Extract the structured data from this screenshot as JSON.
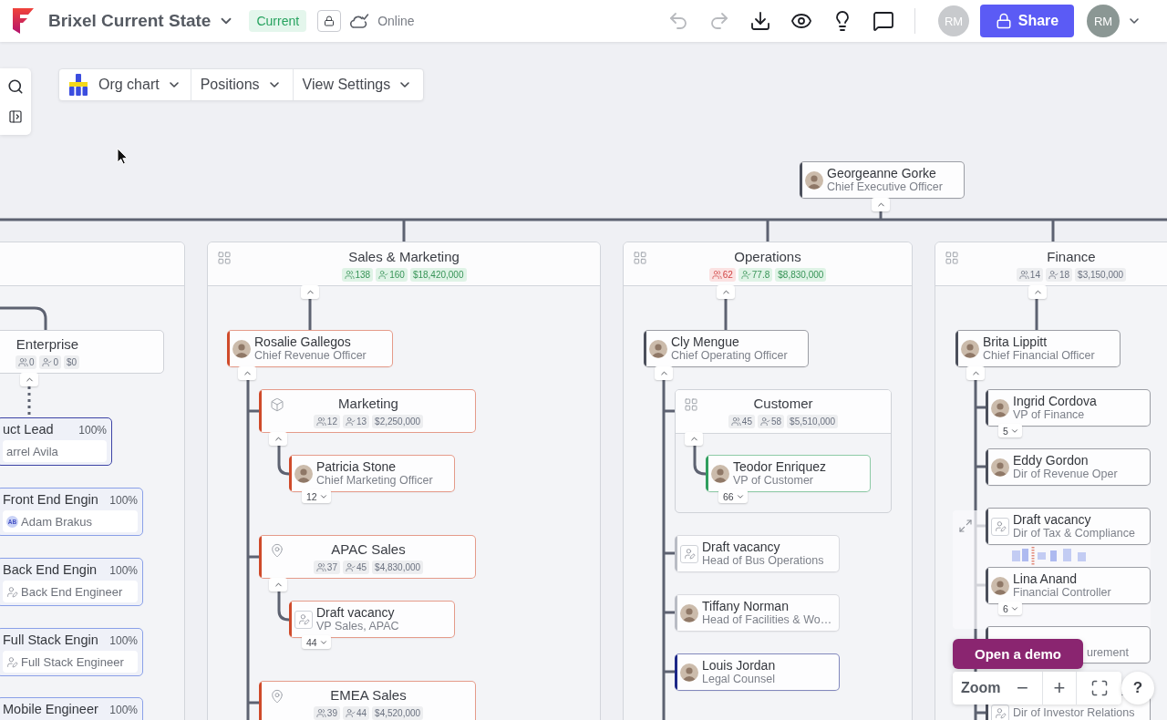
{
  "app_bar": {
    "title": "Brixel Current State",
    "status": "Current",
    "connection": "Online",
    "actions": [
      {
        "kind": "undo",
        "disabled": true
      },
      {
        "kind": "redo",
        "disabled": true
      },
      {
        "kind": "download",
        "disabled": false
      },
      {
        "kind": "preview",
        "disabled": false
      },
      {
        "kind": "insights",
        "disabled": false
      },
      {
        "kind": "comments",
        "disabled": false
      }
    ],
    "collaborator": "RM",
    "share": "Share",
    "account": "RM"
  },
  "view_toolbar": [
    {
      "kind": "chart",
      "label": "Org chart"
    },
    {
      "kind": "menu",
      "label": "Positions"
    },
    {
      "kind": "menu",
      "label": "View Settings"
    }
  ],
  "org_chart": {
    "root": {
      "kind": "person",
      "name": "Georgeanne Gorke",
      "role": "Chief Executive Officer",
      "color": "#4b4f5b",
      "expanded": true
    },
    "departments": [
      {
        "children": [
          {
            "kind": "unit",
            "title": "Enterprise",
            "stats": [
              {
                "kind": "people",
                "value": "0",
                "color": "#edeef0"
              },
              {
                "kind": "positions",
                "value": "0",
                "color": "#edeef0"
              },
              {
                "kind": "budget",
                "value": "$0",
                "color": "#edeef0"
              }
            ],
            "expanded": true,
            "children": [
              {
                "kind": "position",
                "title": "uct Lead",
                "fill": "100%",
                "holder": {
                  "name": "arrel Avila"
                },
                "color": "#3d44a6"
              }
            ]
          },
          {
            "kind": "position",
            "title": "Front End Engin",
            "fill": "100%",
            "holder": {
              "kind": "person",
              "initials": "AB",
              "name": "Adam Brakus"
            },
            "color": "#8aa0e8"
          },
          {
            "kind": "position",
            "title": "Back End Engin",
            "fill": "100%",
            "holder": {
              "kind": "vacancy",
              "name": "Back End Engineer"
            },
            "color": "#8aa0e8"
          },
          {
            "kind": "position",
            "title": "Full Stack Engin",
            "fill": "100%",
            "holder": {
              "kind": "vacancy",
              "name": "Full Stack Engineer"
            },
            "color": "#8aa0e8"
          },
          {
            "kind": "position",
            "title": "Mobile Engineer",
            "fill": "100%",
            "color": "#8aa0e8"
          }
        ]
      },
      {
        "kind": "group",
        "title": "Sales & Marketing",
        "stats": [
          {
            "kind": "people",
            "value": "138",
            "color": "#dff3e6"
          },
          {
            "kind": "positions",
            "value": "160",
            "color": "#dff3e6"
          },
          {
            "kind": "budget",
            "value": "$18,420,000",
            "color": "#dff3e6"
          }
        ],
        "expanded": true,
        "children": [
          {
            "kind": "person",
            "name": "Rosalie Gallegos",
            "role": "Chief Revenue Officer",
            "color": "#cf4a2a",
            "expanded": true,
            "children": [
              {
                "kind": "function",
                "title": "Marketing",
                "stats": [
                  {
                    "kind": "people",
                    "value": "12",
                    "color": "#edeef0"
                  },
                  {
                    "kind": "positions",
                    "value": "13",
                    "color": "#edeef0"
                  },
                  {
                    "kind": "budget",
                    "value": "$2,250,000",
                    "color": "#edeef0"
                  }
                ],
                "color": "#cf4a2a",
                "expanded": true,
                "children": [
                  {
                    "kind": "person",
                    "name": "Patricia Stone",
                    "role": "Chief Marketing Officer",
                    "color": "#cf4a2a",
                    "expanded": false,
                    "reports": "12"
                  }
                ]
              },
              {
                "kind": "location",
                "title": "APAC Sales",
                "stats": [
                  {
                    "kind": "people",
                    "value": "37",
                    "color": "#edeef0"
                  },
                  {
                    "kind": "positions",
                    "value": "45",
                    "color": "#edeef0"
                  },
                  {
                    "kind": "budget",
                    "value": "$4,830,000",
                    "color": "#edeef0"
                  }
                ],
                "color": "#cf4a2a",
                "expanded": true,
                "children": [
                  {
                    "kind": "vacancy",
                    "name": "Draft vacancy",
                    "role": "VP Sales, APAC",
                    "color": "#cf4a2a",
                    "expanded": false,
                    "reports": "44"
                  }
                ]
              },
              {
                "kind": "location",
                "title": "EMEA Sales",
                "stats": [
                  {
                    "kind": "people",
                    "value": "39",
                    "color": "#edeef0"
                  },
                  {
                    "kind": "positions",
                    "value": "44",
                    "color": "#edeef0"
                  },
                  {
                    "kind": "budget",
                    "value": "$4,520,000",
                    "color": "#edeef0"
                  }
                ],
                "color": "#cf4a2a"
              }
            ]
          }
        ]
      },
      {
        "kind": "group",
        "title": "Operations",
        "stats": [
          {
            "kind": "people",
            "value": "62",
            "color": "#fbe2e2"
          },
          {
            "kind": "positions",
            "value": "77.8",
            "color": "#dff3e6"
          },
          {
            "kind": "budget",
            "value": "$8,830,000",
            "color": "#dff3e6"
          }
        ],
        "expanded": true,
        "children": [
          {
            "kind": "person",
            "name": "Cly Mengue",
            "role": "Chief Operating Officer",
            "color": "#4b4f5b",
            "expanded": true,
            "children": [
              {
                "kind": "group",
                "title": "Customer",
                "stats": [
                  {
                    "kind": "people",
                    "value": "45",
                    "color": "#edeef0"
                  },
                  {
                    "kind": "positions",
                    "value": "58",
                    "color": "#edeef0"
                  },
                  {
                    "kind": "budget",
                    "value": "$5,510,000",
                    "color": "#edeef0"
                  }
                ],
                "expanded": true,
                "children": [
                  {
                    "kind": "person",
                    "name": "Teodor Enriquez",
                    "role": "VP of Customer",
                    "color": "#2f9e5e",
                    "expanded": false,
                    "reports": "66"
                  }
                ]
              },
              {
                "kind": "vacancy",
                "name": "Draft vacancy",
                "role": "Head of Bus Operations",
                "color": "#b9bcc4"
              },
              {
                "kind": "person",
                "name": "Tiffany Norman",
                "role": "Head of Facilities & Wo…",
                "color": "#b9bcc4"
              },
              {
                "kind": "person",
                "name": "Louis Jordan",
                "role": "Legal Counsel",
                "color": "#1c2787"
              }
            ]
          }
        ]
      },
      {
        "kind": "group",
        "title": "Finance",
        "stats": [
          {
            "kind": "people",
            "value": "14",
            "color": "#edeef0"
          },
          {
            "kind": "positions",
            "value": "18",
            "color": "#edeef0"
          },
          {
            "kind": "budget",
            "value": "$3,150,000",
            "color": "#edeef0"
          }
        ],
        "expanded": true,
        "children": [
          {
            "kind": "person",
            "name": "Brita Lippitt",
            "role": "Chief Financial Officer",
            "color": "#4b4f5b",
            "expanded": true,
            "children": [
              {
                "kind": "person",
                "name": "Ingrid Cordova",
                "role": "VP of Finance",
                "color": "#4b4f5b",
                "expanded": false,
                "reports": "5"
              },
              {
                "kind": "person",
                "name": "Eddy Gordon",
                "role": "Dir of Revenue Oper",
                "color": "#4b4f5b"
              },
              {
                "kind": "vacancy",
                "name": "Draft vacancy",
                "role": "Dir of Tax & Compliance",
                "color": "#4b4f5b"
              },
              {
                "kind": "person",
                "name": "Lina Anand",
                "role": "Financial Controller",
                "color": "#4b4f5b",
                "expanded": false,
                "reports": "6"
              },
              {
                "kind": "person",
                "role": "urement",
                "color": "#4b4f5b"
              },
              {
                "kind": "vacancy",
                "role": "Dir of Investor Relations",
                "color": "#4b4f5b"
              }
            ]
          }
        ]
      }
    ]
  },
  "canvas_controls": {
    "demo": "Open a demo",
    "zoom_label": "Zoom",
    "zoom_out": "−",
    "zoom_in": "+",
    "help": "?"
  }
}
